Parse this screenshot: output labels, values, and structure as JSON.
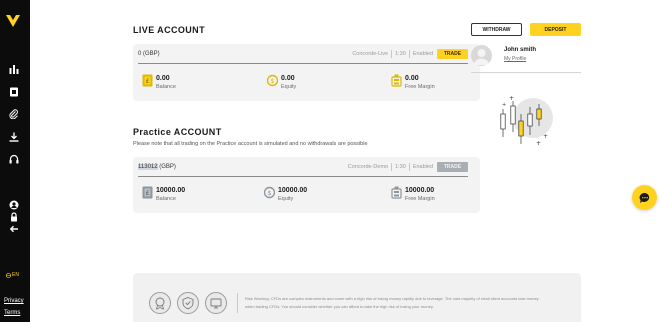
{
  "sidebar": {
    "items": [
      {
        "icon": "bar-chart-icon"
      },
      {
        "icon": "book-icon"
      },
      {
        "icon": "paperclip-icon"
      },
      {
        "icon": "download-icon"
      },
      {
        "icon": "headphones-icon"
      }
    ],
    "bottom_items": [
      {
        "icon": "user-icon"
      },
      {
        "icon": "lock-icon"
      },
      {
        "icon": "logout-arrow-icon"
      }
    ],
    "language": "EN",
    "links": {
      "privacy": "Privacy",
      "terms": "Terms"
    },
    "accent_color": "#ffd21f",
    "background": "#0c0c0c"
  },
  "live": {
    "title": "LIVE ACCOUNT",
    "account_id": "0 (GBP)",
    "server": "Concorde-Live",
    "leverage": "1:30",
    "status": "Enabled",
    "trade_label": "TRADE",
    "balance": {
      "value": "0.00",
      "label": "Balance"
    },
    "equity": {
      "value": "0.00",
      "label": "Equity"
    },
    "free_margin": {
      "value": "0.00",
      "label": "Free Margin"
    }
  },
  "practice": {
    "title": "Practice ACCOUNT",
    "note": "Please note that all trading on the Practice account is simulated and no withdrawals are possible",
    "account_number": "113012",
    "currency": " (GBP)",
    "server": "Concorde-Demo",
    "leverage": "1:30",
    "status": "Enabled",
    "trade_label": "TRADE",
    "balance": {
      "value": "10000.00",
      "label": "Balance"
    },
    "equity": {
      "value": "10000.00",
      "label": "Equity"
    },
    "free_margin": {
      "value": "10000.00",
      "label": "Free Margin"
    }
  },
  "actions": {
    "withdraw": "WITHDRAW",
    "deposit": "DEPOSIT"
  },
  "profile": {
    "name": "John smith",
    "link": "My Profile"
  },
  "footer": {
    "badges": [
      {
        "icon": "seal-badge-icon"
      },
      {
        "icon": "shield-badge-icon"
      },
      {
        "icon": "monitor-badge-icon"
      }
    ],
    "risk_line1": "Risk Warning: CFDs are complex instruments and come with a high risk of losing money rapidly due to leverage. The vast majority of retail client accounts lose money",
    "risk_line2": "when trading CFDs. You should consider whether you can afford to take the high risk of losing your money."
  },
  "colors": {
    "accent": "#ffd21f",
    "card": "#f3f3f3",
    "demo_button": "#a7aeb6"
  }
}
